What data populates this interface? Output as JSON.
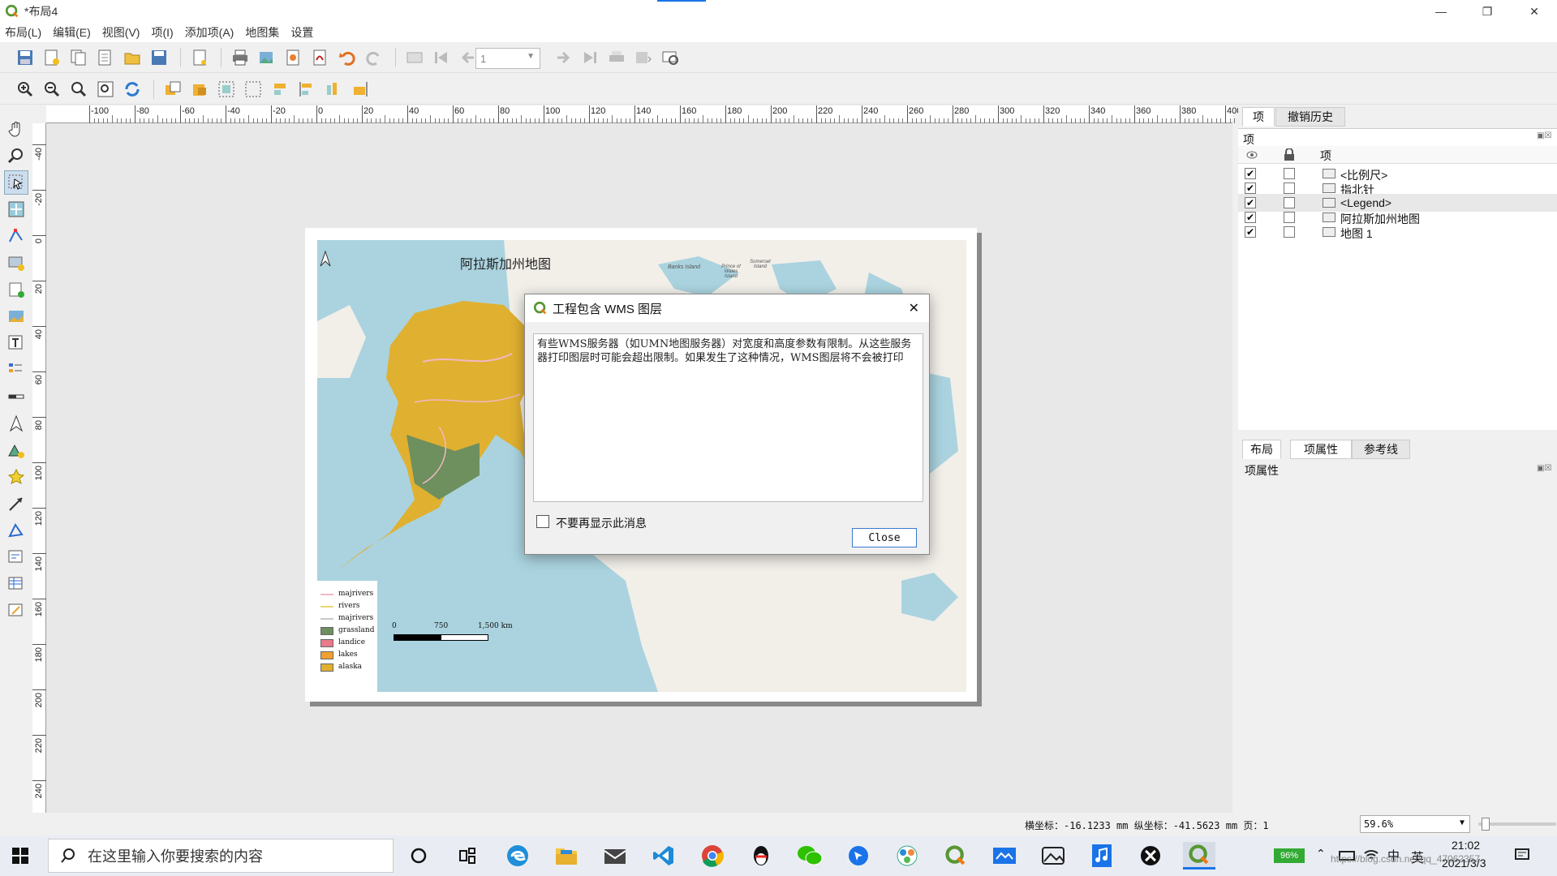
{
  "window": {
    "title": "*布局4"
  },
  "menu": [
    "布局(L)",
    "编辑(E)",
    "视图(V)",
    "项(I)",
    "添加项(A)",
    "地图集",
    "设置"
  ],
  "toolbar": {
    "page_value": "1"
  },
  "ruler": {
    "h_labels": [
      "-100",
      "-80",
      "-60",
      "-40",
      "-20",
      "0",
      "20",
      "40",
      "60",
      "80",
      "100",
      "120",
      "140",
      "160",
      "180",
      "200",
      "220",
      "240",
      "260",
      "280",
      "300",
      "320",
      "340",
      "360",
      "380",
      "400"
    ],
    "v_labels": [
      "-40",
      "-20",
      "0",
      "20",
      "40",
      "60",
      "80",
      "100",
      "120",
      "140",
      "160",
      "180",
      "200",
      "220",
      "240"
    ]
  },
  "map": {
    "title": "阿拉斯加州地图",
    "places": [
      "Banks Island",
      "Prince of Wales Island",
      "Somerset Island"
    ],
    "legend": [
      {
        "label": "majrivers",
        "color": "#f2b8c6",
        "kind": "line"
      },
      {
        "label": "rivers",
        "color": "#e8d878",
        "kind": "line"
      },
      {
        "label": "majrivers",
        "color": "#c8c8c8",
        "kind": "line"
      },
      {
        "label": "grassland",
        "color": "#6e8f5e",
        "kind": "box"
      },
      {
        "label": "landice",
        "color": "#e87a8a",
        "kind": "box"
      },
      {
        "label": "lakes",
        "color": "#f0a030",
        "kind": "box"
      },
      {
        "label": "alaska",
        "color": "#e0b030",
        "kind": "box"
      }
    ],
    "scalebar": {
      "labels": [
        "0",
        "750",
        "1,500 km"
      ]
    }
  },
  "dialog": {
    "title": "工程包含 WMS 图层",
    "message": "有些WMS服务器（如UMN地图服务器）对宽度和高度参数有限制。从这些服务器打印图层时可能会超出限制。如果发生了这种情况，WMS图层将不会被打印",
    "checkbox_label": "不要再显示此消息",
    "close_label": "Close"
  },
  "right_panel": {
    "top_tabs": [
      "项",
      "撤销历史"
    ],
    "items_title": "项",
    "column_header": "项",
    "items": [
      {
        "label": "<比例尺>",
        "visible": true,
        "locked": false,
        "icon": "scalebar-icon"
      },
      {
        "label": "指北针",
        "visible": true,
        "locked": false,
        "icon": "picture-icon"
      },
      {
        "label": "<Legend>",
        "visible": true,
        "locked": false,
        "icon": "legend-icon"
      },
      {
        "label": "阿拉斯加州地图",
        "visible": true,
        "locked": false,
        "icon": "label-icon"
      },
      {
        "label": "地图 1",
        "visible": true,
        "locked": false,
        "icon": "map-icon"
      }
    ],
    "bottom_tabs": [
      "布局",
      "项属性",
      "参考线"
    ],
    "props_title": "项属性"
  },
  "status": {
    "coords": "横坐标：-16.1233 mm 纵坐标：-41.5623 mm 页：1",
    "zoom": "59.6%"
  },
  "taskbar": {
    "search_placeholder": "在这里输入你要搜索的内容",
    "battery": "96%",
    "ime": "英",
    "ime_mode": "中",
    "time": "21:02",
    "date": "2021/3/3",
    "watermark": "https://blog.csdn.net/qq_47062357"
  }
}
